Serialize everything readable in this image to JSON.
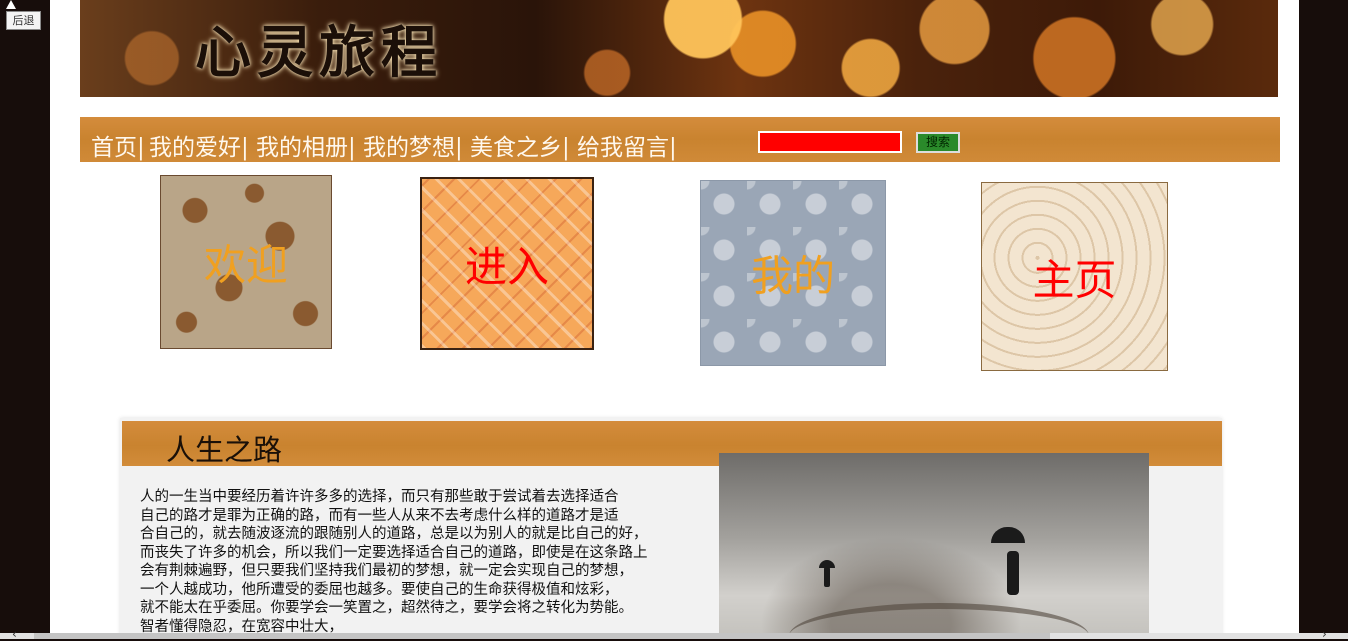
{
  "browser": {
    "back_label": "后退"
  },
  "banner": {
    "title": "心灵旅程"
  },
  "nav": {
    "items": [
      {
        "label": "首页",
        "sep": "|"
      },
      {
        "label": "我的爱好",
        "sep": "|"
      },
      {
        "label": "我的相册",
        "sep": "|"
      },
      {
        "label": "我的梦想",
        "sep": "|"
      },
      {
        "label": "美食之乡",
        "sep": "|"
      },
      {
        "label": "给我留言",
        "sep": "|"
      }
    ],
    "search_value": "",
    "search_button": "搜索"
  },
  "tiles": [
    {
      "label": "欢迎",
      "color": "#f0a020"
    },
    {
      "label": "进入",
      "color": "#ff0000"
    },
    {
      "label": "我的",
      "color": "#f0a020"
    },
    {
      "label": "主页",
      "color": "#ff0000"
    }
  ],
  "section": {
    "title": "人生之路",
    "body": "人的一生当中要经历着许许多多的选择，而只有那些敢于尝试着去选择适合\n自己的路才是罪为正确的路，而有一些人从来不去考虑什么样的道路才是适\n合自己的，就去随波逐流的跟随别人的道路，总是以为别人的就是比自己的好，\n而丧失了许多的机会，所以我们一定要选择适合自己的道路，即使是在这条路上\n会有荆棘遍野，但只要我们坚持我们最初的梦想，就一定会实现自己的梦想，\n一个人越成功，他所遭受的委屈也越多。要使自己的生命获得极值和炫彩，\n就不能太在乎委屈。你要学会一笑置之，超然待之，要学会将之转化为势能。\n智者懂得隐忍，在宽容中壮大，"
  },
  "scrollbar": {
    "left_arrow": "‹",
    "right_arrow": "›"
  }
}
